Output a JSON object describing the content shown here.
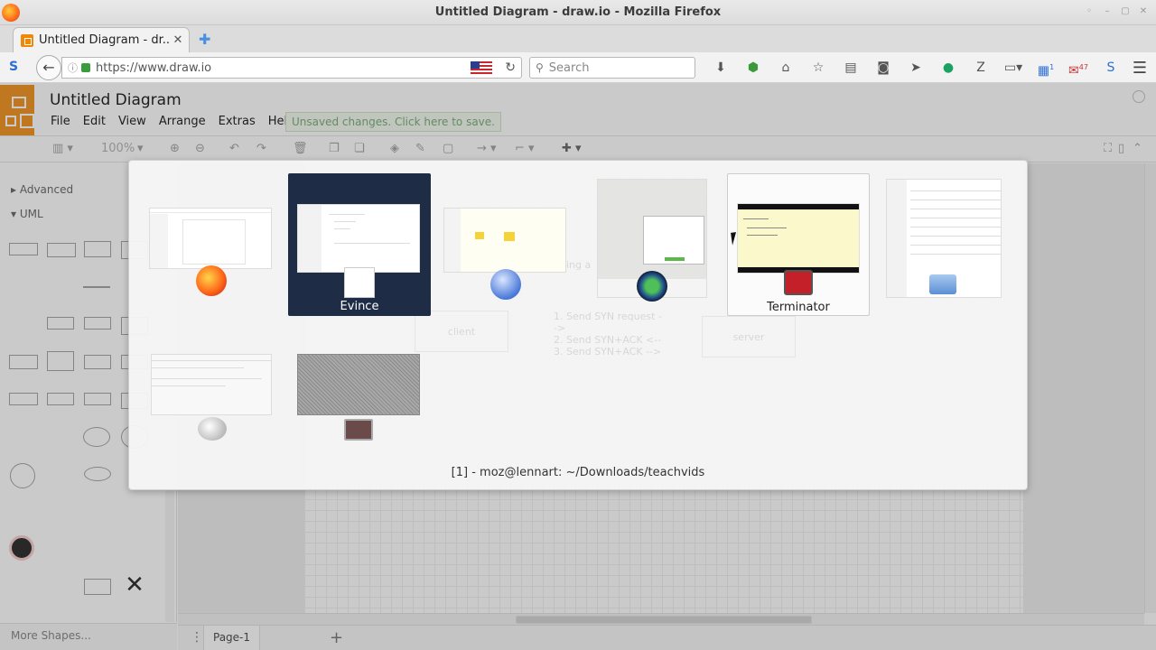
{
  "window": {
    "title": "Untitled Diagram - draw.io - Mozilla Firefox"
  },
  "tab": {
    "title": "Untitled Diagram - dr...",
    "close": "✕",
    "new": "✚"
  },
  "nav": {
    "url": "https://www.draw.io",
    "search_placeholder": "Search",
    "icons": [
      "download-icon",
      "extension-icon",
      "home-icon",
      "bookmark-star-icon",
      "reading-list-icon",
      "pocket-icon",
      "send-icon",
      "hangouts-icon",
      "zotero-icon",
      "reader-icon",
      "dropdown-icon",
      "badge-1-icon",
      "notification-4-7-icon",
      "skype-icon"
    ],
    "badges": {
      "ext1": "1",
      "ext2a": "4",
      "ext2b": "7"
    }
  },
  "app": {
    "diagram_title": "Untitled Diagram",
    "menu": [
      "File",
      "Edit",
      "View",
      "Arrange",
      "Extras",
      "Help"
    ],
    "unsaved_notice": "Unsaved changes. Click here to save.",
    "zoom": "100%"
  },
  "sidebar": {
    "sections": [
      "Advanced",
      "UML"
    ],
    "more_shapes": "More Shapes..."
  },
  "canvas": {
    "ghost_texts": {
      "client": "client",
      "server": "server",
      "steps": [
        "1. Send SYN request -->",
        "2. Send SYN+ACK <--",
        "3. Send SYN+ACK -->"
      ],
      "faint": "ing a"
    }
  },
  "pagebar": {
    "page": "Page-1"
  },
  "switcher": {
    "windows": [
      {
        "id": "firefox",
        "label": "",
        "icon": "firefox-icon"
      },
      {
        "id": "evince",
        "label": "Evince",
        "icon": "evince-icon"
      },
      {
        "id": "yed",
        "label": "",
        "icon": "yed-icon"
      },
      {
        "id": "camera",
        "label": "",
        "icon": "camera-icon"
      },
      {
        "id": "terminator",
        "label": "Terminator",
        "icon": "terminator-icon"
      },
      {
        "id": "files",
        "label": "",
        "icon": "folder-icon"
      },
      {
        "id": "xchat",
        "label": "",
        "icon": "xchat-icon"
      },
      {
        "id": "vnc",
        "label": "",
        "icon": "vnc-icon"
      }
    ],
    "caption": "[1] - moz@lennart: ~/Downloads/teachvids"
  },
  "colors": {
    "drawio_orange": "#f08705",
    "selected_bg": "#1e2d45",
    "unsaved_text": "#6aa36a"
  }
}
